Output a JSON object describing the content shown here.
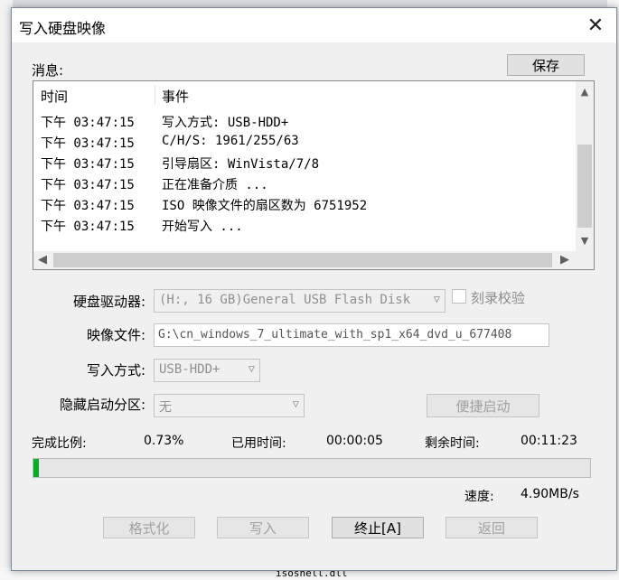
{
  "window": {
    "title": "写入硬盘映像",
    "close_glyph": "✕"
  },
  "messages": {
    "label": "消息:",
    "save_button": "保存",
    "columns": {
      "time": "时间",
      "event": "事件"
    },
    "rows": [
      {
        "time": "下午 03:47:15",
        "event": "写入方式: USB-HDD+"
      },
      {
        "time": "下午 03:47:15",
        "event": "C/H/S: 1961/255/63"
      },
      {
        "time": "下午 03:47:15",
        "event": "引导扇区: WinVista/7/8"
      },
      {
        "time": "下午 03:47:15",
        "event": "正在准备介质 ..."
      },
      {
        "time": "下午 03:47:15",
        "event": "ISO 映像文件的扇区数为 6751952"
      },
      {
        "time": "下午 03:47:15",
        "event": "开始写入 ..."
      }
    ]
  },
  "form": {
    "disk_label": "硬盘驱动器:",
    "disk_value": "(H:, 16 GB)General USB Flash Disk",
    "verify_label": "刻录校验",
    "image_label": "映像文件:",
    "image_value": "G:\\cn_windows_7_ultimate_with_sp1_x64_dvd_u_677408",
    "method_label": "写入方式:",
    "method_value": "USB-HDD+",
    "hidden_label": "隐藏启动分区:",
    "hidden_value": "无",
    "quick_boot": "便捷启动"
  },
  "status": {
    "done_label": "完成比例:",
    "done_value": "0.73%",
    "elapsed_label": "已用时间:",
    "elapsed_value": "00:00:05",
    "remaining_label": "剩余时间:",
    "remaining_value": "00:11:23",
    "speed_label": "速度:",
    "speed_value": "4.90MB/s",
    "progress_fraction": 0.0073
  },
  "buttons": {
    "format": "格式化",
    "write": "写入",
    "stop": "终止[A]",
    "back": "返回"
  },
  "background": {
    "file_name": "isoshell.dll"
  },
  "colors": {
    "progress": "#06b025"
  }
}
